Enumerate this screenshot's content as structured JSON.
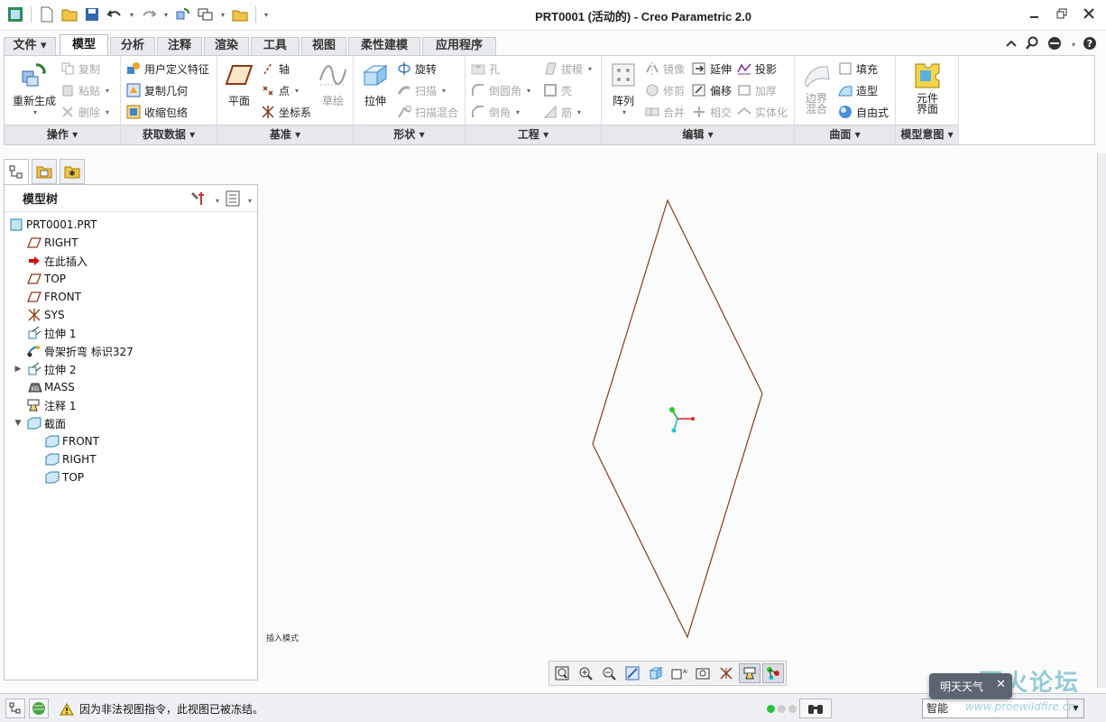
{
  "window": {
    "title": "PRT0001 (活动的) - Creo Parametric 2.0"
  },
  "tabs": [
    {
      "label": "文件 ▾",
      "active": false
    },
    {
      "label": "模型",
      "active": true
    },
    {
      "label": "分析",
      "active": false
    },
    {
      "label": "注释",
      "active": false
    },
    {
      "label": "渲染",
      "active": false
    },
    {
      "label": "工具",
      "active": false
    },
    {
      "label": "视图",
      "active": false
    },
    {
      "label": "柔性建模",
      "active": false
    },
    {
      "label": "应用程序",
      "active": false
    }
  ],
  "ribbon": {
    "groups": {
      "operations": "操作",
      "get_data": "获取数据",
      "datum": "基准",
      "shapes": "形状",
      "engineering": "工程",
      "editing": "编辑",
      "surfaces": "曲面",
      "model_intent": "模型意图"
    },
    "regenerate": "重新生成",
    "copy": "复制",
    "paste": "粘贴",
    "delete": "删除",
    "user_feature": "用户定义特征",
    "copy_geometry": "复制几何",
    "shrinkwrap": "收缩包络",
    "plane": "平面",
    "axis": "轴",
    "point": "点",
    "csys": "坐标系",
    "sketch": "草绘",
    "extrude": "拉伸",
    "revolve": "旋转",
    "sweep": "扫描",
    "swept_blend": "扫描混合",
    "hole": "孔",
    "round": "倒圆角",
    "chamfer": "倒角",
    "draft": "拔模",
    "shell": "壳",
    "rib": "筋",
    "pattern": "阵列",
    "mirror": "镜像",
    "trim": "修剪",
    "merge": "合并",
    "extend": "延伸",
    "offset": "偏移",
    "intersect": "相交",
    "project": "投影",
    "thicken": "加厚",
    "solidify": "实体化",
    "boundary_blend": "边界混合",
    "fill": "填充",
    "style": "造型",
    "freestyle": "自由式",
    "component_interface": "元件界面"
  },
  "model_tree": {
    "title": "模型树",
    "nodes": [
      {
        "label": "PRT0001.PRT",
        "icon": "part-icon",
        "indent": 0,
        "expand": ""
      },
      {
        "label": "RIGHT",
        "icon": "datum-plane-icon",
        "indent": 1,
        "expand": ""
      },
      {
        "label": "在此插入",
        "icon": "insert-here-arrow-icon",
        "indent": 1,
        "expand": ""
      },
      {
        "label": "TOP",
        "icon": "datum-plane-icon",
        "indent": 1,
        "expand": ""
      },
      {
        "label": "FRONT",
        "icon": "datum-plane-icon",
        "indent": 1,
        "expand": ""
      },
      {
        "label": "SYS",
        "icon": "csys-icon",
        "indent": 1,
        "expand": ""
      },
      {
        "label": "拉伸 1",
        "icon": "extrude-icon",
        "indent": 1,
        "expand": ""
      },
      {
        "label": "骨架折弯 标识327",
        "icon": "spinal-bend-icon",
        "indent": 1,
        "expand": ""
      },
      {
        "label": "拉伸 2",
        "icon": "extrude-icon",
        "indent": 1,
        "expand": "▶"
      },
      {
        "label": "MASS",
        "icon": "mass-icon",
        "indent": 1,
        "expand": ""
      },
      {
        "label": "注释 1",
        "icon": "annotation-icon",
        "indent": 1,
        "expand": ""
      },
      {
        "label": "截面",
        "icon": "section-folder-icon",
        "indent": 1,
        "expand": "▼"
      },
      {
        "label": "FRONT",
        "icon": "section-icon",
        "indent": 2,
        "expand": ""
      },
      {
        "label": "RIGHT",
        "icon": "section-icon",
        "indent": 2,
        "expand": ""
      },
      {
        "label": "TOP",
        "icon": "section-icon",
        "indent": 2,
        "expand": ""
      }
    ]
  },
  "graphics": {
    "insert_mode": "插入模式",
    "shape_color": "#8b3a1a"
  },
  "status": {
    "message": "因为非法视图指令，此视图已被冻结。",
    "filter": "智能"
  },
  "overlay": {
    "weather": "明天天气",
    "watermark": "野火论坛",
    "watermark_url": "www.proewildfire.cn"
  }
}
